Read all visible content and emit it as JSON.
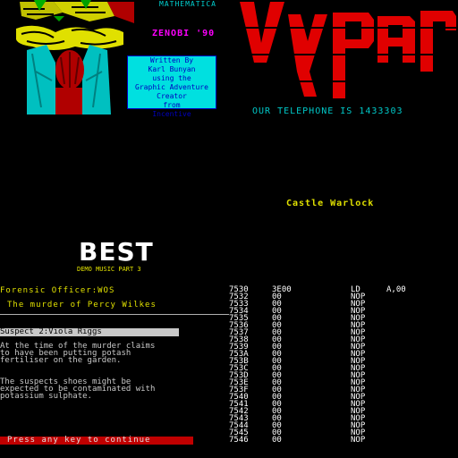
{
  "top_left": {
    "mathematica_label": "MATHEMATICA",
    "zenobi_label": "ZENOBI '90",
    "credits": [
      "Written By",
      "Karl Bunyan",
      "using the",
      "Graphic Adventure",
      "Creator",
      "from",
      "Incentive"
    ]
  },
  "logo_text": "Vypar",
  "phone_line": "OUR TELEPHONE IS  1433303",
  "castle_title": "Castle Warlock",
  "best": {
    "big": "BEST",
    "small": "DEMO MUSIC PART 3"
  },
  "game_text": {
    "forensic": "Forensic Officer:WOS",
    "murder_title": "The murder of Percy Wilkes",
    "suspect_header": "Suspect 2:Viola Riggs",
    "paragraph1": [
      "At the time of the murder claims",
      "to have been putting potash",
      "fertiliser on the garden."
    ],
    "paragraph2": [
      "The suspects shoes might be",
      "expected to be contaminated with",
      "potassium sulphate."
    ],
    "press_key": "Press any key to continue"
  },
  "listing": [
    {
      "addr": "7530",
      "byte": "3E00",
      "op": "LD",
      "arg": "A,00"
    },
    {
      "addr": "7532",
      "byte": "00",
      "op": "NOP",
      "arg": ""
    },
    {
      "addr": "7533",
      "byte": "00",
      "op": "NOP",
      "arg": ""
    },
    {
      "addr": "7534",
      "byte": "00",
      "op": "NOP",
      "arg": ""
    },
    {
      "addr": "7535",
      "byte": "00",
      "op": "NOP",
      "arg": ""
    },
    {
      "addr": "7536",
      "byte": "00",
      "op": "NOP",
      "arg": ""
    },
    {
      "addr": "7537",
      "byte": "00",
      "op": "NOP",
      "arg": ""
    },
    {
      "addr": "7538",
      "byte": "00",
      "op": "NOP",
      "arg": ""
    },
    {
      "addr": "7539",
      "byte": "00",
      "op": "NOP",
      "arg": ""
    },
    {
      "addr": "753A",
      "byte": "00",
      "op": "NOP",
      "arg": ""
    },
    {
      "addr": "753B",
      "byte": "00",
      "op": "NOP",
      "arg": ""
    },
    {
      "addr": "753C",
      "byte": "00",
      "op": "NOP",
      "arg": ""
    },
    {
      "addr": "753D",
      "byte": "00",
      "op": "NOP",
      "arg": ""
    },
    {
      "addr": "753E",
      "byte": "00",
      "op": "NOP",
      "arg": ""
    },
    {
      "addr": "753F",
      "byte": "00",
      "op": "NOP",
      "arg": ""
    },
    {
      "addr": "7540",
      "byte": "00",
      "op": "NOP",
      "arg": ""
    },
    {
      "addr": "7541",
      "byte": "00",
      "op": "NOP",
      "arg": ""
    },
    {
      "addr": "7542",
      "byte": "00",
      "op": "NOP",
      "arg": ""
    },
    {
      "addr": "7543",
      "byte": "00",
      "op": "NOP",
      "arg": ""
    },
    {
      "addr": "7544",
      "byte": "00",
      "op": "NOP",
      "arg": ""
    },
    {
      "addr": "7545",
      "byte": "00",
      "op": "NOP",
      "arg": ""
    },
    {
      "addr": "7546",
      "byte": "00",
      "op": "NOP",
      "arg": ""
    }
  ],
  "colors": {
    "background": "#000000",
    "cyan": "#00c8c8",
    "yellow": "#e0e000",
    "red": "#e00000",
    "magenta": "#ff00ff",
    "white": "#ffffff"
  }
}
